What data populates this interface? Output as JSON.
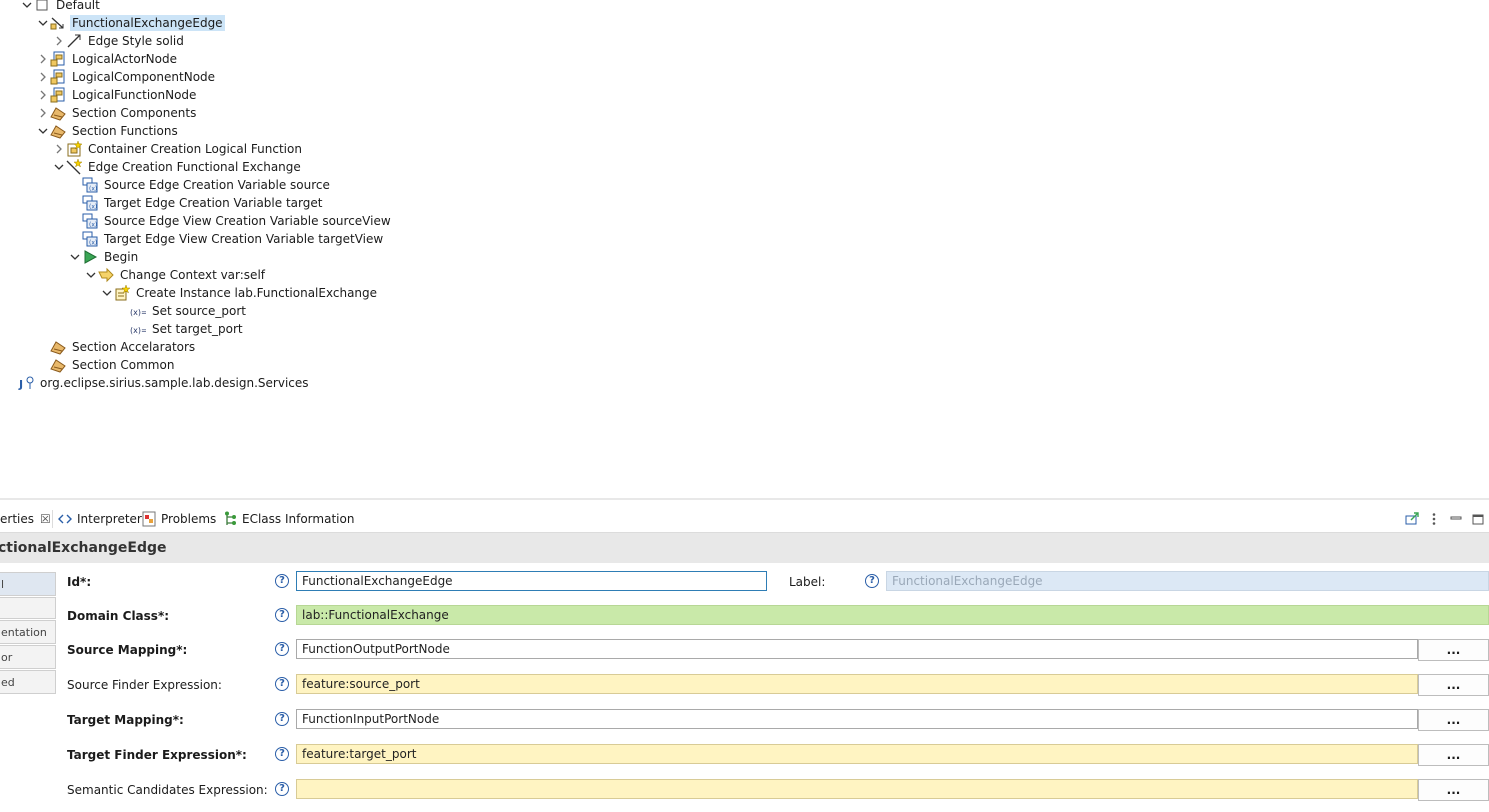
{
  "tree": {
    "nodes": [
      {
        "label": "Default",
        "expanded": true,
        "icon": "layer-checkbox-icon"
      },
      {
        "label": "FunctionalExchangeEdge",
        "expanded": true,
        "icon": "edge-mapping-icon",
        "selected": true
      },
      {
        "label": "Edge Style solid",
        "expanded": false,
        "icon": "edge-style-icon"
      },
      {
        "label": "LogicalActorNode",
        "expanded": false,
        "icon": "node-mapping-icon"
      },
      {
        "label": "LogicalComponentNode",
        "expanded": false,
        "icon": "node-mapping-icon"
      },
      {
        "label": "LogicalFunctionNode",
        "expanded": false,
        "icon": "node-mapping-icon"
      },
      {
        "label": "Section Components",
        "expanded": false,
        "icon": "tool-section-icon"
      },
      {
        "label": "Section Functions",
        "expanded": true,
        "icon": "tool-section-icon"
      },
      {
        "label": "Container Creation Logical Function",
        "expanded": false,
        "icon": "container-creation-icon"
      },
      {
        "label": "Edge Creation Functional Exchange",
        "expanded": true,
        "icon": "edge-creation-icon"
      },
      {
        "label": "Source Edge Creation Variable source",
        "icon": "variable-icon"
      },
      {
        "label": "Target Edge Creation Variable target",
        "icon": "variable-icon"
      },
      {
        "label": "Source Edge View Creation Variable sourceView",
        "icon": "variable-icon"
      },
      {
        "label": "Target Edge View Creation Variable targetView",
        "icon": "variable-icon"
      },
      {
        "label": "Begin",
        "expanded": true,
        "icon": "begin-icon"
      },
      {
        "label": "Change Context var:self",
        "expanded": true,
        "icon": "change-context-icon"
      },
      {
        "label": "Create Instance lab.FunctionalExchange",
        "expanded": true,
        "icon": "create-instance-icon"
      },
      {
        "label": "Set source_port",
        "icon": "set-value-icon"
      },
      {
        "label": "Set target_port",
        "icon": "set-value-icon"
      },
      {
        "label": "Section Accelarators",
        "icon": "tool-section-icon"
      },
      {
        "label": "Section Common",
        "icon": "tool-section-icon"
      },
      {
        "label": "org.eclipse.sirius.sample.lab.design.Services",
        "icon": "java-extension-icon"
      }
    ]
  },
  "views": {
    "tabs": [
      {
        "label": "erties",
        "icon": "properties-icon",
        "active": true
      },
      {
        "label": "Interpreter",
        "icon": "interpreter-icon"
      },
      {
        "label": "Problems",
        "icon": "problems-icon"
      },
      {
        "label": "EClass Information",
        "icon": "eclass-info-icon"
      }
    ],
    "close_glyph": "☒",
    "toolbar": [
      "pin-icon",
      "view-menu-icon",
      "minimize-icon",
      "maximize-icon"
    ]
  },
  "properties": {
    "title": "ctionalExchangeEdge",
    "side_tabs": [
      "l",
      "",
      "entation",
      "or",
      "ed"
    ],
    "rows": [
      {
        "label": "Id*:",
        "bold": true,
        "value": "FunctionalExchangeEdge",
        "style": "focus"
      },
      {
        "label": "Domain Class*:",
        "bold": true,
        "value": "lab::FunctionalExchange",
        "style": "green"
      },
      {
        "label": "Source Mapping*:",
        "bold": true,
        "value": "FunctionOutputPortNode",
        "style": "plain",
        "button": "..."
      },
      {
        "label": "Source Finder Expression:",
        "bold": false,
        "value": "feature:source_port",
        "style": "yellow",
        "button": "..."
      },
      {
        "label": "Target Mapping*:",
        "bold": true,
        "value": "FunctionInputPortNode",
        "style": "plain",
        "button": "..."
      },
      {
        "label": "Target Finder Expression*:",
        "bold": true,
        "value": "feature:target_port",
        "style": "yellow",
        "button": "..."
      },
      {
        "label": "Semantic Candidates Expression:",
        "bold": false,
        "value": "",
        "style": "yellow",
        "button": "..."
      }
    ],
    "label_field": {
      "label": "Label:",
      "value": "FunctionalExchangeEdge"
    },
    "help_glyph": "?"
  },
  "colors": {
    "selection": "#cce4f7",
    "green_field": "#c9e9a9",
    "yellow_field": "#fff4c2"
  }
}
